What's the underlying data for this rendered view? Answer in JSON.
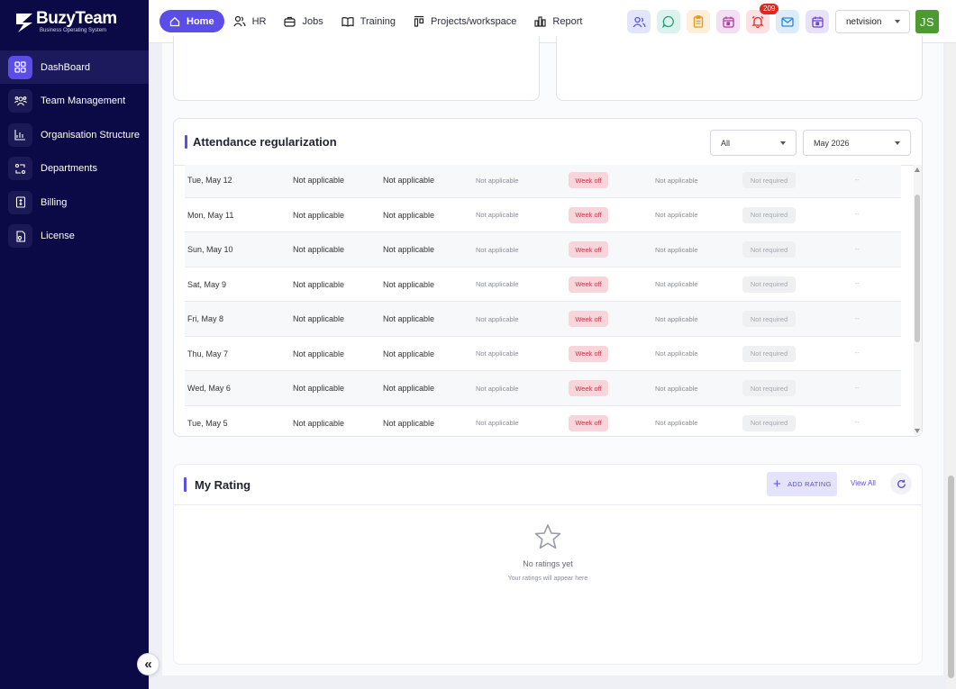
{
  "brand": {
    "name": "BuzyTeam",
    "tagline": "Business Operating System"
  },
  "sidebar": {
    "items": [
      {
        "label": "DashBoard",
        "icon": "dashboard-grid-icon"
      },
      {
        "label": "Team Management",
        "icon": "team-icon"
      },
      {
        "label": "Organisation Structure",
        "icon": "org-chart-icon"
      },
      {
        "label": "Departments",
        "icon": "departments-icon"
      },
      {
        "label": "Billing",
        "icon": "billing-icon"
      },
      {
        "label": "License",
        "icon": "license-icon"
      }
    ],
    "collapse_label": "«"
  },
  "topbar": {
    "tabs": [
      {
        "label": "Home",
        "icon": "home-icon"
      },
      {
        "label": "HR",
        "icon": "people-icon"
      },
      {
        "label": "Jobs",
        "icon": "briefcase-icon"
      },
      {
        "label": "Training",
        "icon": "book-icon"
      },
      {
        "label": "Projects/workspace",
        "icon": "projects-icon"
      },
      {
        "label": "Report",
        "icon": "report-chart-icon"
      }
    ],
    "notification_count": "209",
    "org_select": "netvision",
    "avatar_initials": "JS"
  },
  "attendance": {
    "title": "Attendance regularization",
    "filter_value": "All",
    "month_value": "May 2026",
    "rows": [
      {
        "date": "Tue, May 12",
        "c2": "Not applicable",
        "c3": "Not applicable",
        "c4": "Not applicable",
        "status": "Week off",
        "c6": "Not applicable",
        "approval": "Not required",
        "action": "--"
      },
      {
        "date": "Mon, May 11",
        "c2": "Not applicable",
        "c3": "Not applicable",
        "c4": "Not applicable",
        "status": "Week off",
        "c6": "Not applicable",
        "approval": "Not required",
        "action": "--"
      },
      {
        "date": "Sun, May 10",
        "c2": "Not applicable",
        "c3": "Not applicable",
        "c4": "Not applicable",
        "status": "Week off",
        "c6": "Not applicable",
        "approval": "Not required",
        "action": "--"
      },
      {
        "date": "Sat, May 9",
        "c2": "Not applicable",
        "c3": "Not applicable",
        "c4": "Not applicable",
        "status": "Week off",
        "c6": "Not applicable",
        "approval": "Not required",
        "action": "--"
      },
      {
        "date": "Fri, May 8",
        "c2": "Not applicable",
        "c3": "Not applicable",
        "c4": "Not applicable",
        "status": "Week off",
        "c6": "Not applicable",
        "approval": "Not required",
        "action": "--"
      },
      {
        "date": "Thu, May 7",
        "c2": "Not applicable",
        "c3": "Not applicable",
        "c4": "Not applicable",
        "status": "Week off",
        "c6": "Not applicable",
        "approval": "Not required",
        "action": "--"
      },
      {
        "date": "Wed, May 6",
        "c2": "Not applicable",
        "c3": "Not applicable",
        "c4": "Not applicable",
        "status": "Week off",
        "c6": "Not applicable",
        "approval": "Not required",
        "action": "--"
      },
      {
        "date": "Tue, May 5",
        "c2": "Not applicable",
        "c3": "Not applicable",
        "c4": "Not applicable",
        "status": "Week off",
        "c6": "Not applicable",
        "approval": "Not required",
        "action": "--"
      }
    ]
  },
  "rating": {
    "title": "My Rating",
    "add_label": "ADD RATING",
    "view_all": "View All",
    "empty_title": "No ratings yet",
    "empty_sub": "Your ratings will appear here"
  },
  "colors": {
    "sidebar_bg": "#0c0a46",
    "accent": "#5b4ee8",
    "week_off_bg": "#f8d5da",
    "week_off_text": "#c2364a"
  }
}
